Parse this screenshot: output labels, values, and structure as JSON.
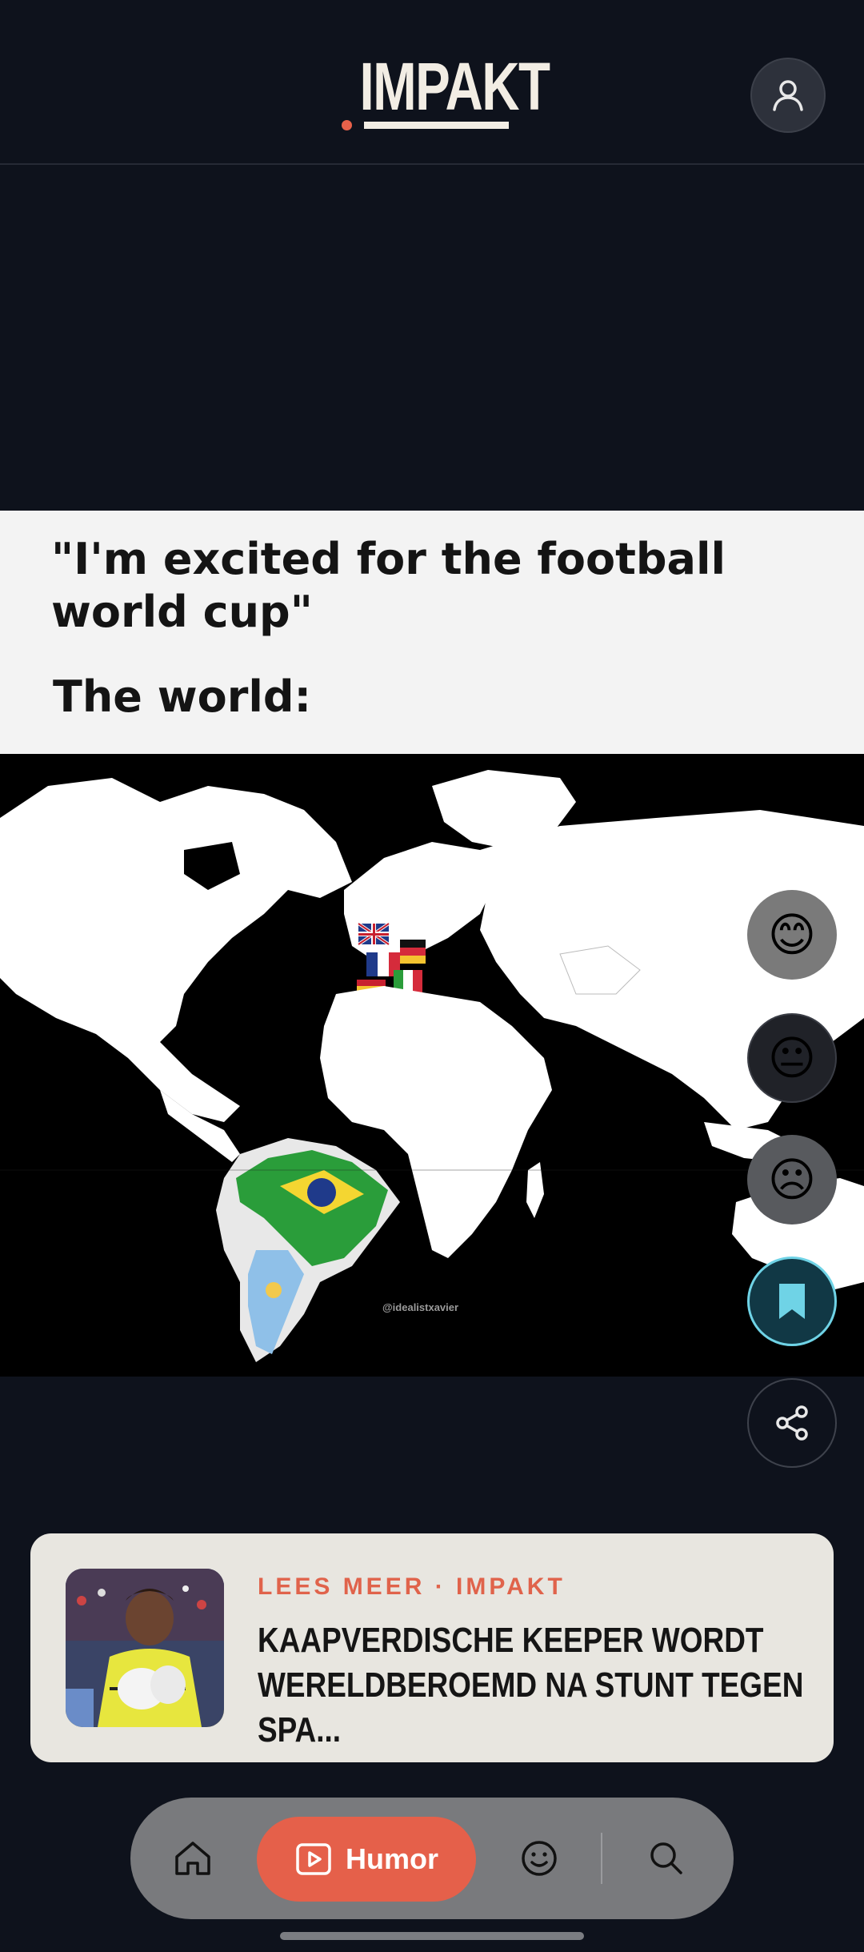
{
  "header": {
    "logo_text": "IMPAKT",
    "account_icon": "user-icon"
  },
  "meme": {
    "caption_line1": "\"I'm excited for the football world cup\"",
    "caption_line2": "The world:",
    "map_credit": "@idealistxavier"
  },
  "actions": {
    "reactions": [
      {
        "icon": "smiling-face-icon",
        "glyph": "😊"
      },
      {
        "icon": "neutral-face-icon",
        "glyph": "😐"
      },
      {
        "icon": "frowning-face-icon",
        "glyph": "☹"
      }
    ],
    "save_icon": "bookmark-icon",
    "share_icon": "share-icon"
  },
  "read_more": {
    "kicker": "LEES MEER · IMPAKT",
    "title": "KAAPVERDISCHE KEEPER WORDT WERELDBEROEMD NA STUNT TEGEN SPA..."
  },
  "nav": {
    "home_icon": "home-icon",
    "active_label": "Humor",
    "active_icon": "play-icon",
    "emoji_icon": "smiley-icon",
    "search_icon": "search-icon"
  },
  "colors": {
    "background": "#0e121c",
    "accent": "#e5604a",
    "save_ring": "#6fd3e6",
    "card": "#e8e6e0"
  }
}
